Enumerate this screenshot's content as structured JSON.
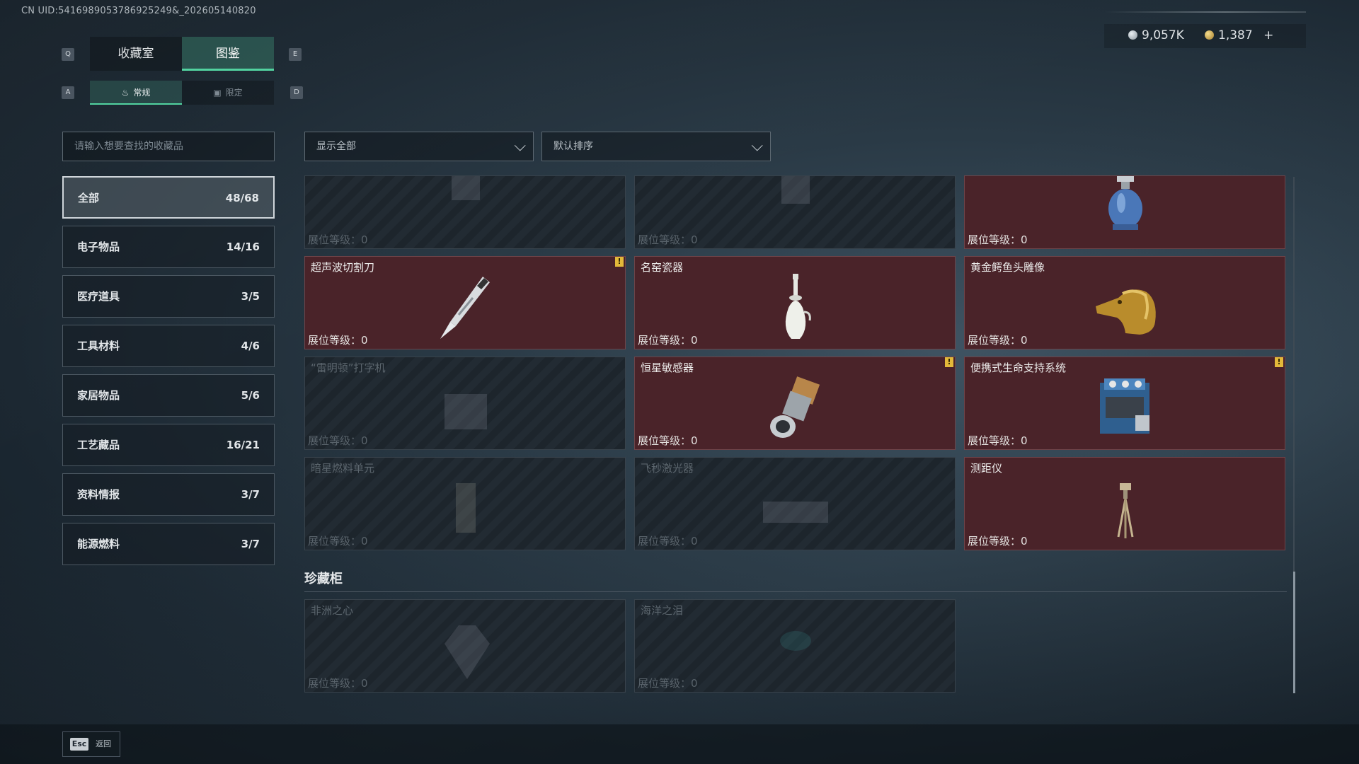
{
  "uid": "CN UID:5416989053786925249&_202605140820",
  "top_tabs": {
    "left_key": "Q",
    "right_key": "E",
    "tab1": "收藏室",
    "tab2": "图鉴"
  },
  "sub_tabs": {
    "left_key": "A",
    "right_key": "D",
    "sub1": "常规",
    "sub2": "限定"
  },
  "currency": {
    "silver": "9,057K",
    "gold": "1,387",
    "add": "+"
  },
  "search": {
    "placeholder": "请输入想要查找的收藏品"
  },
  "filters": {
    "show": "显示全部",
    "sort": "默认排序"
  },
  "categories": [
    {
      "label": "全部",
      "count": "48/68"
    },
    {
      "label": "电子物品",
      "count": "14/16"
    },
    {
      "label": "医疗道具",
      "count": "3/5"
    },
    {
      "label": "工具材料",
      "count": "4/6"
    },
    {
      "label": "家居物品",
      "count": "5/6"
    },
    {
      "label": "工艺藏品",
      "count": "16/21"
    },
    {
      "label": "资料情报",
      "count": "3/7"
    },
    {
      "label": "能源燃料",
      "count": "3/7"
    }
  ],
  "level_label": "展位等级：",
  "cards": [
    {
      "name": "",
      "level": "0"
    },
    {
      "name": "",
      "level": "0"
    },
    {
      "name": "",
      "level": "0"
    },
    {
      "name": "超声波切割刀",
      "level": "0",
      "warn": "!"
    },
    {
      "name": "名窑瓷器",
      "level": "0"
    },
    {
      "name": "黄金鳄鱼头雕像",
      "level": "0"
    },
    {
      "name": "“雷明顿”打字机",
      "level": "0"
    },
    {
      "name": "恒星敏感器",
      "level": "0",
      "warn": "!"
    },
    {
      "name": "便携式生命支持系统",
      "level": "0",
      "warn": "!"
    },
    {
      "name": "暗星燃料单元",
      "level": "0"
    },
    {
      "name": "飞秒激光器",
      "level": "0"
    },
    {
      "name": "测距仪",
      "level": "0"
    }
  ],
  "section": {
    "title": "珍藏柜"
  },
  "treasure_cards": [
    {
      "name": "非洲之心",
      "level": "0"
    },
    {
      "name": "海洋之泪",
      "level": "0"
    }
  ],
  "footer": {
    "key": "Esc",
    "label": "返回"
  },
  "colors": {
    "accent": "#52d3a0",
    "owned_card": "#4a2329",
    "warning": "#e3b93a"
  },
  "icons": {
    "card_0": "missing-item-icon",
    "card_1": "missing-item-icon",
    "card_2": "gas-canister-icon",
    "card_3": "ultrasonic-knife-icon",
    "card_4": "porcelain-vase-icon",
    "card_5": "gold-crocodile-head-icon",
    "card_6": "typewriter-icon",
    "card_7": "star-sensor-icon",
    "card_8": "life-support-icon",
    "card_9": "fuel-cell-icon",
    "card_10": "laser-icon",
    "card_11": "rangefinder-tripod-icon",
    "treasure_0": "diamond-icon",
    "treasure_1": "gem-icon"
  }
}
